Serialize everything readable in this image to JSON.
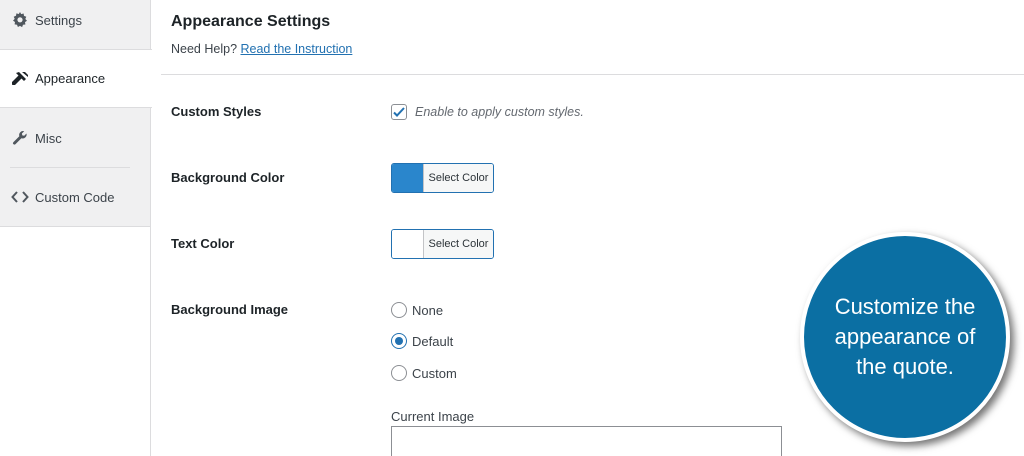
{
  "sidebar": {
    "items": [
      {
        "label": "Settings",
        "icon": "gear-icon"
      },
      {
        "label": "Appearance",
        "icon": "brush-icon",
        "active": true
      },
      {
        "label": "Misc",
        "icon": "wrench-icon"
      },
      {
        "label": "Custom Code",
        "icon": "code-icon"
      }
    ]
  },
  "header": {
    "title": "Appearance Settings",
    "help_prefix": "Need Help?",
    "help_link": "Read the Instruction"
  },
  "form": {
    "custom_styles": {
      "label": "Custom Styles",
      "checked": true,
      "description": "Enable to apply custom styles."
    },
    "background_color": {
      "label": "Background Color",
      "button": "Select Color",
      "color": "#2a86cc"
    },
    "text_color": {
      "label": "Text Color",
      "button": "Select Color",
      "color": "#ffffff"
    },
    "background_image": {
      "label": "Background Image",
      "options": [
        "None",
        "Default",
        "Custom"
      ],
      "selected": "Default",
      "current_image_label": "Current Image"
    }
  },
  "callout": {
    "line1": "Customize the",
    "line2": "appearance of",
    "line3": "the quote.",
    "color": "#0b6fa3"
  },
  "colors": {
    "accent": "#2271b1"
  }
}
